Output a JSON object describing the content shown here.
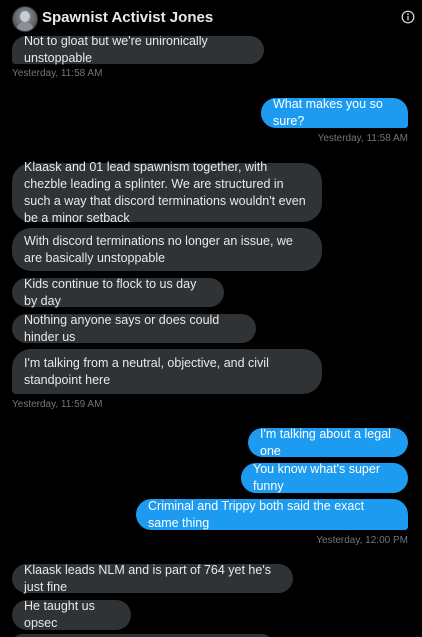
{
  "header": {
    "name": "Spawnist Activist Jones",
    "avatar_icon": "avatar-photo",
    "info_icon": "info-icon"
  },
  "colors": {
    "background": "#000000",
    "incoming_bubble": "#2f3336",
    "outgoing_bubble": "#1d9bf0",
    "timestamp": "#71767b"
  },
  "messages": [
    {
      "side": "in",
      "text": "Not to gloat but we're unironically unstoppable"
    },
    {
      "side": "out",
      "text": "What makes you so sure?"
    },
    {
      "side": "in",
      "text": "Klaask and 01 lead spawnism together, with chezble leading a splinter. We are structured in such a way that discord terminations wouldn't even be a minor setback"
    },
    {
      "side": "in",
      "text": "With discord terminations no longer an issue, we are basically unstoppable"
    },
    {
      "side": "in",
      "text": "Kids continue to flock to us day by day"
    },
    {
      "side": "in",
      "text": "Nothing anyone says or does could hinder us"
    },
    {
      "side": "in",
      "text": "I'm talking from a neutral, objective, and civil standpoint here"
    },
    {
      "side": "out",
      "text": "I'm talking about a legal one"
    },
    {
      "side": "out",
      "text": "You know what's super funny"
    },
    {
      "side": "out",
      "text": "Criminal and Trippy both said the exact same thing"
    },
    {
      "side": "in",
      "text": "Klaask leads NLM and is part of 764 yet he's just fine"
    },
    {
      "side": "in",
      "text": "He taught us opsec"
    }
  ],
  "timestamps": [
    "Yesterday, 11:58 AM",
    "Yesterday, 11:58 AM",
    "Yesterday, 11:59 AM",
    "Yesterday, 12:00 PM"
  ]
}
